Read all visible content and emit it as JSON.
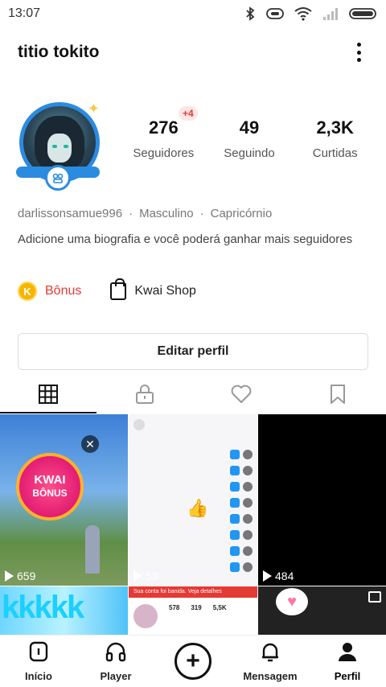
{
  "status_bar": {
    "time": "13:07"
  },
  "header": {
    "username": "titio tokito"
  },
  "profile": {
    "stats": [
      {
        "value": "276",
        "label": "Seguidores"
      },
      {
        "value": "49",
        "label": "Seguindo"
      },
      {
        "value": "2,3K",
        "label": "Curtidas"
      }
    ],
    "followers_badge": "+4",
    "meta": {
      "handle": "darlissonsamue996",
      "gender": "Masculino",
      "sign": "Capricórnio",
      "separator": "·"
    },
    "bio": "Adicione uma biografia e você poderá ganhar mais seguidores",
    "shortcuts": {
      "bonus": "Bônus",
      "bonus_coin": "K",
      "shop": "Kwai Shop"
    },
    "edit_button": "Editar perfil"
  },
  "grid": {
    "items": [
      {
        "views": "659",
        "badge_title": "KWAI",
        "badge_subtitle": "BÔNUS",
        "close": "✕"
      },
      {
        "views": "53"
      },
      {
        "views": "484"
      }
    ],
    "row2": {
      "text_art": "kkkkk",
      "banner": "Sua conta foi banida. Veja detalhes",
      "mini_stats": [
        "578",
        "319",
        "5,5K"
      ]
    }
  },
  "bottom_nav": [
    {
      "label": "Início"
    },
    {
      "label": "Player"
    },
    {
      "label": "+"
    },
    {
      "label": "Mensagem"
    },
    {
      "label": "Perfil"
    }
  ]
}
